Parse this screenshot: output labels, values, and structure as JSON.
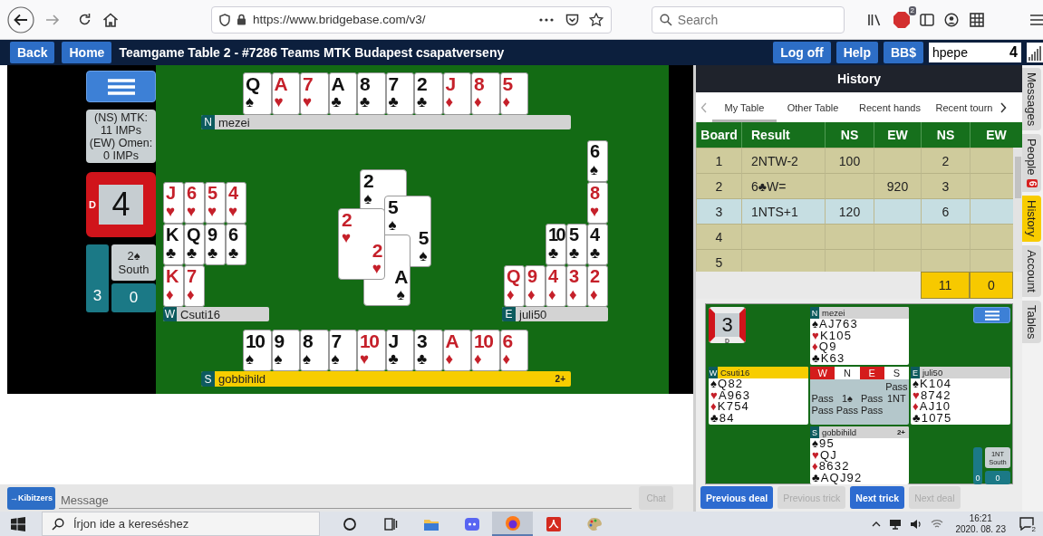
{
  "browser": {
    "url": "https://www.bridgebase.com/v3/",
    "search_placeholder": "Search",
    "addon_badge": "2"
  },
  "title_bar": {
    "left_buttons": [
      "Back",
      "Home"
    ],
    "title": "Teamgame Table 2 - #7286 Teams MTK Budapest csapatverseny",
    "right_buttons": [
      "Log off",
      "Help",
      "BB$"
    ],
    "username": "hpepe",
    "count": "4"
  },
  "left_panel": {
    "score_lines": [
      "(NS) MTK:",
      "11 IMPs",
      "(EW) Omen:",
      "0 IMPs"
    ],
    "board": {
      "number": "4",
      "dealer_marks": {
        "west": "D"
      },
      "ns_vulnerable": true,
      "ew_vulnerable": true
    },
    "contract": {
      "bid": "2♠",
      "declarer": "South",
      "left_tricks": "3",
      "right_tricks": "0"
    }
  },
  "table": {
    "north": {
      "seat": "N",
      "name": "mezei",
      "active": false,
      "cards": [
        {
          "rank": "Q",
          "suit": "♠",
          "color": "#111111"
        },
        {
          "rank": "A",
          "suit": "♥",
          "color": "#c5202a"
        },
        {
          "rank": "7",
          "suit": "♥",
          "color": "#c5202a"
        },
        {
          "rank": "A",
          "suit": "♣",
          "color": "#111111"
        },
        {
          "rank": "8",
          "suit": "♣",
          "color": "#111111"
        },
        {
          "rank": "7",
          "suit": "♣",
          "color": "#111111"
        },
        {
          "rank": "2",
          "suit": "♣",
          "color": "#111111"
        },
        {
          "rank": "J",
          "suit": "♦",
          "color": "#c5202a"
        },
        {
          "rank": "8",
          "suit": "♦",
          "color": "#c5202a"
        },
        {
          "rank": "5",
          "suit": "♦",
          "color": "#c5202a"
        }
      ]
    },
    "west": {
      "seat": "W",
      "name": "Csuti16",
      "active": false,
      "rows": [
        [
          {
            "rank": "J",
            "suit": "♥",
            "color": "#c5202a"
          },
          {
            "rank": "6",
            "suit": "♥",
            "color": "#c5202a"
          },
          {
            "rank": "5",
            "suit": "♥",
            "color": "#c5202a"
          },
          {
            "rank": "4",
            "suit": "♥",
            "color": "#c5202a"
          }
        ],
        [
          {
            "rank": "K",
            "suit": "♣",
            "color": "#111111"
          },
          {
            "rank": "Q",
            "suit": "♣",
            "color": "#111111"
          },
          {
            "rank": "9",
            "suit": "♣",
            "color": "#111111"
          },
          {
            "rank": "6",
            "suit": "♣",
            "color": "#111111"
          }
        ],
        [
          {
            "rank": "K",
            "suit": "♦",
            "color": "#c5202a"
          },
          {
            "rank": "7",
            "suit": "♦",
            "color": "#c5202a"
          }
        ]
      ]
    },
    "east": {
      "seat": "E",
      "name": "juli50",
      "active": false,
      "rows": [
        [
          null,
          null,
          null,
          null,
          {
            "rank": "6",
            "suit": "♠",
            "color": "#111111"
          }
        ],
        [
          null,
          null,
          null,
          null,
          {
            "rank": "8",
            "suit": "♥",
            "color": "#c5202a"
          }
        ],
        [
          null,
          null,
          {
            "rank": "10",
            "suit": "♣",
            "color": "#111111"
          },
          {
            "rank": "5",
            "suit": "♣",
            "color": "#111111"
          },
          {
            "rank": "4",
            "suit": "♣",
            "color": "#111111"
          }
        ],
        [
          {
            "rank": "Q",
            "suit": "♦",
            "color": "#c5202a"
          },
          {
            "rank": "9",
            "suit": "♦",
            "color": "#c5202a"
          },
          {
            "rank": "4",
            "suit": "♦",
            "color": "#c5202a"
          },
          {
            "rank": "3",
            "suit": "♦",
            "color": "#c5202a"
          },
          {
            "rank": "2",
            "suit": "♦",
            "color": "#c5202a"
          }
        ]
      ]
    },
    "south": {
      "seat": "S",
      "name": "gobbihild",
      "active": true,
      "badge": "2+",
      "cards": [
        {
          "rank": "10",
          "suit": "♠",
          "color": "#111111"
        },
        {
          "rank": "9",
          "suit": "♠",
          "color": "#111111"
        },
        {
          "rank": "8",
          "suit": "♠",
          "color": "#111111"
        },
        {
          "rank": "7",
          "suit": "♠",
          "color": "#111111"
        },
        {
          "rank": "10",
          "suit": "♥",
          "color": "#c5202a"
        },
        {
          "rank": "J",
          "suit": "♣",
          "color": "#111111"
        },
        {
          "rank": "3",
          "suit": "♣",
          "color": "#111111"
        },
        {
          "rank": "A",
          "suit": "♦",
          "color": "#c5202a"
        },
        {
          "rank": "10",
          "suit": "♦",
          "color": "#c5202a"
        },
        {
          "rank": "6",
          "suit": "♦",
          "color": "#c5202a"
        }
      ]
    },
    "trick": {
      "north": {
        "top": {
          "rank": "2",
          "suit": "♠",
          "color": "#111111"
        }
      },
      "east": {
        "top": {
          "rank": "5",
          "suit": "♠",
          "color": "#111111"
        },
        "bottom": {
          "rank": "5",
          "suit": "♠",
          "color": "#111111"
        }
      },
      "south": {
        "bottom": {
          "rank": "A",
          "suit": "♠",
          "color": "#111111"
        }
      },
      "west": {
        "top": {
          "rank": "2",
          "suit": "♥",
          "color": "#c5202a"
        },
        "bottom": {
          "rank": "2",
          "suit": "♥",
          "color": "#c5202a"
        }
      }
    }
  },
  "chat": {
    "kibitzers_button": "→Kibitzers",
    "placeholder": "Message",
    "send_button": "Chat",
    "send_disabled": true
  },
  "history": {
    "title": "History",
    "tabs": [
      {
        "label": "My Table",
        "selected": true
      },
      {
        "label": "Other Table",
        "selected": false
      },
      {
        "label": "Recent hands",
        "selected": false
      },
      {
        "label": "Recent tourn",
        "selected": false
      }
    ],
    "columns": [
      "Board",
      "Result",
      "NS",
      "EW",
      "NS",
      "EW"
    ],
    "rows": [
      {
        "cells": [
          "1",
          "2NTW-2",
          "100",
          null,
          "2",
          null
        ],
        "selected": false
      },
      {
        "cells": [
          "2",
          "6♣W=",
          null,
          "920",
          "3",
          null
        ],
        "selected": false
      },
      {
        "cells": [
          "3",
          "1NTS+1",
          "120",
          null,
          "6",
          null
        ],
        "selected": true
      },
      {
        "cells": [
          "4",
          null,
          null,
          null,
          null,
          null
        ],
        "selected": false
      },
      {
        "cells": [
          "5",
          null,
          null,
          null,
          null,
          null
        ],
        "selected": false
      }
    ],
    "totals": [
      "11",
      "0"
    ]
  },
  "mini_board": {
    "board": {
      "number": "3",
      "dealer_marks": {
        "south": "D"
      },
      "ns_vulnerable": false,
      "ew_vulnerable": true
    },
    "hands": {
      "north": {
        "seat": "N",
        "name": "mezei",
        "active": false,
        "lines": [
          {
            "suit": "♠",
            "cards": "AJ763",
            "color": "#111111"
          },
          {
            "suit": "♥",
            "cards": "K105",
            "color": "#c5202a"
          },
          {
            "suit": "♦",
            "cards": "Q9",
            "color": "#c5202a"
          },
          {
            "suit": "♣",
            "cards": "K63",
            "color": "#111111"
          }
        ]
      },
      "west": {
        "seat": "W",
        "name": "Csuti16",
        "active": true,
        "lines": [
          {
            "suit": "♠",
            "cards": "Q82",
            "color": "#111111"
          },
          {
            "suit": "♥",
            "cards": "A963",
            "color": "#c5202a"
          },
          {
            "suit": "♦",
            "cards": "K754",
            "color": "#c5202a"
          },
          {
            "suit": "♣",
            "cards": "84",
            "color": "#111111"
          }
        ]
      },
      "east": {
        "seat": "E",
        "name": "juli50",
        "active": false,
        "lines": [
          {
            "suit": "♠",
            "cards": "K104",
            "color": "#111111"
          },
          {
            "suit": "♥",
            "cards": "8742",
            "color": "#c5202a"
          },
          {
            "suit": "♦",
            "cards": "AJ10",
            "color": "#c5202a"
          },
          {
            "suit": "♣",
            "cards": "1075",
            "color": "#111111"
          }
        ]
      },
      "south": {
        "seat": "S",
        "name": "gobbihild",
        "active": false,
        "badge": "2+",
        "lines": [
          {
            "suit": "♠",
            "cards": "95",
            "color": "#111111"
          },
          {
            "suit": "♥",
            "cards": "QJ",
            "color": "#c5202a"
          },
          {
            "suit": "♦",
            "cards": "8632",
            "color": "#c5202a"
          },
          {
            "suit": "♣",
            "cards": "AQJ92",
            "color": "#111111"
          }
        ]
      }
    },
    "bidding": {
      "header": [
        {
          "seat": "W",
          "vulnerable": true
        },
        {
          "seat": "N",
          "vulnerable": false
        },
        {
          "seat": "E",
          "vulnerable": true
        },
        {
          "seat": "S",
          "vulnerable": false
        }
      ],
      "rounds": [
        {
          "south": "Pass"
        },
        {
          "west": "Pass",
          "north": "1♠",
          "east": "Pass",
          "south": "1NT"
        },
        {
          "west": "Pass",
          "north": "Pass",
          "east": "Pass"
        }
      ]
    },
    "contract": {
      "bid": "1NT",
      "declarer": "South",
      "left_tricks": "0",
      "right_tricks": "0"
    },
    "buttons": [
      {
        "label": "Previous deal",
        "disabled": false
      },
      {
        "label": "Previous trick",
        "disabled": true
      },
      {
        "label": "Next trick",
        "disabled": false
      },
      {
        "label": "Next deal",
        "disabled": true
      }
    ]
  },
  "side_tabs": [
    {
      "label": "Messages",
      "selected": false
    },
    {
      "label": "People",
      "badge": "6",
      "selected": false
    },
    {
      "label": "History",
      "selected": true
    },
    {
      "label": "Account",
      "selected": false
    },
    {
      "label": "Tables",
      "selected": false
    }
  ],
  "taskbar": {
    "search_placeholder": "Írjon ide a kereséshez",
    "apps": [
      {
        "kind": "cortana",
        "selected": false
      },
      {
        "kind": "taskview",
        "selected": false
      },
      {
        "kind": "folder",
        "selected": false
      },
      {
        "kind": "chat",
        "selected": false
      },
      {
        "kind": "browser",
        "selected": true
      },
      {
        "kind": "pdf",
        "selected": false
      },
      {
        "kind": "paint",
        "selected": false
      }
    ],
    "time": "16:21",
    "date": "2020. 08. 23",
    "notifications": "2"
  }
}
